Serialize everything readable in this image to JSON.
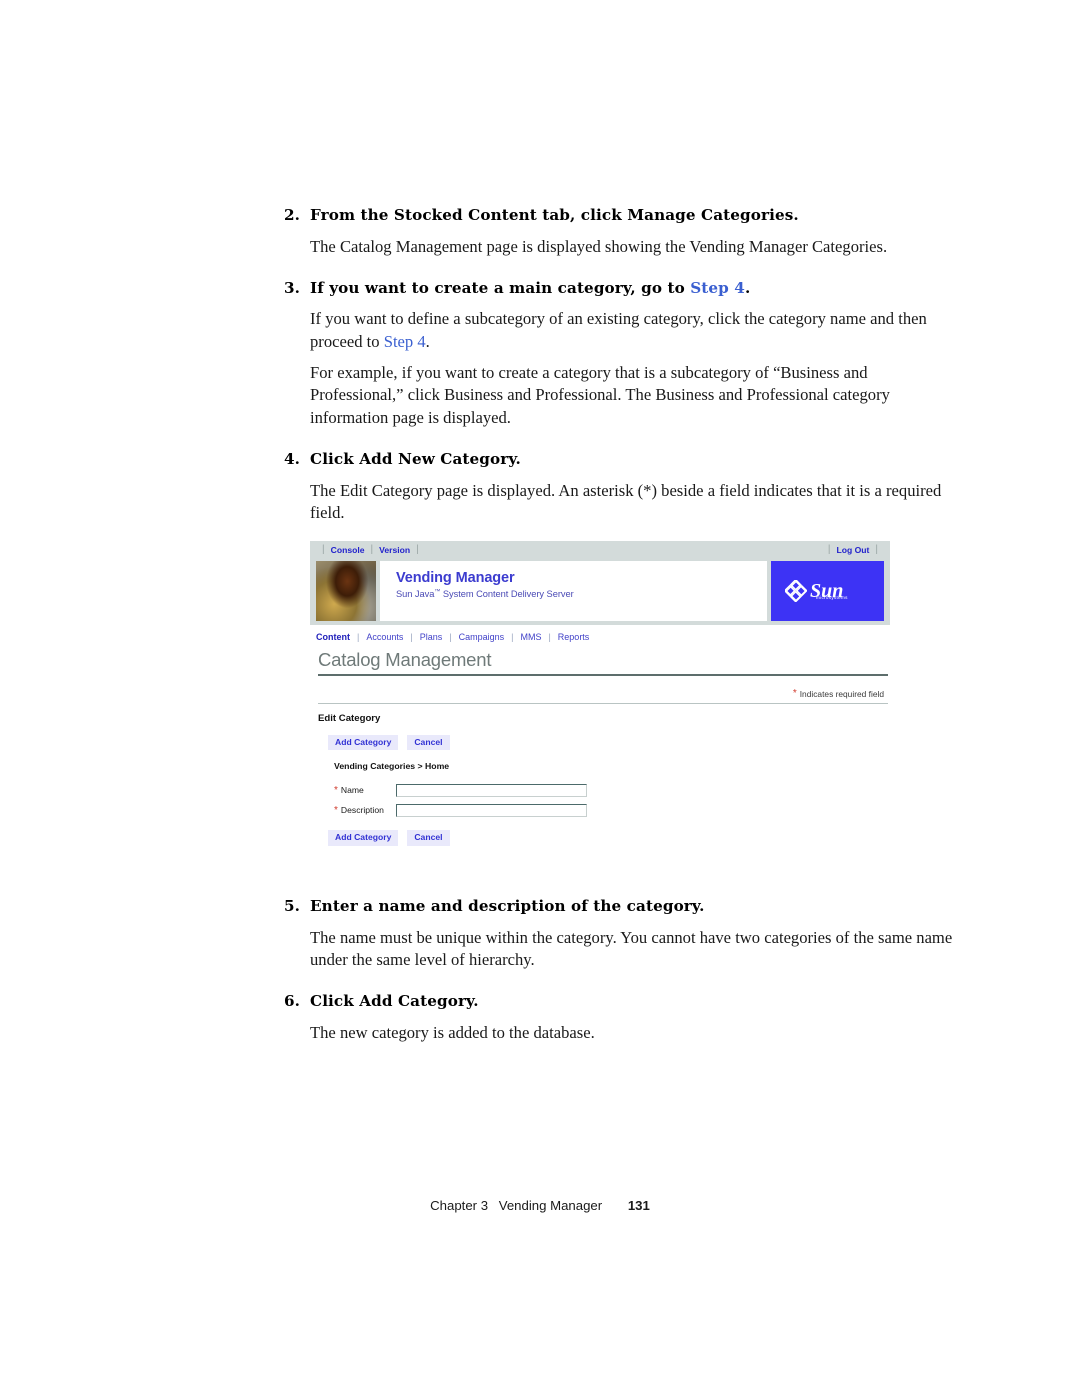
{
  "document": {
    "steps": [
      {
        "number": "2.",
        "heading": "From the Stocked Content tab, click Manage Categories.",
        "body": "The Catalog Management page is displayed showing the Vending Manager Categories."
      },
      {
        "number": "3.",
        "heading_before": "If you want to create a main category, go to ",
        "heading_link": "Step 4",
        "heading_after": ".",
        "body_a_before": "If you want to define a subcategory of an existing category, click the category name and then proceed to ",
        "body_a_link": "Step 4",
        "body_a_after": ".",
        "body_b": "For example, if you want to create a category that is a subcategory of “Business and Professional,” click Business and Professional. The Business and Professional category information page is displayed."
      },
      {
        "number": "4.",
        "heading": "Click Add New Category.",
        "body": "The Edit Category page is displayed. An asterisk (*) beside a field indicates that it is a required field."
      },
      {
        "number": "5.",
        "heading": "Enter a name and description of the category.",
        "body": "The name must be unique within the category. You cannot have two categories of the same name under the same level of hierarchy."
      },
      {
        "number": "6.",
        "heading": "Click Add Category.",
        "body": "The new category is added to the database."
      }
    ]
  },
  "screenshot": {
    "topbar": {
      "console": "Console",
      "version": "Version",
      "logout": "Log Out",
      "separator": "|"
    },
    "banner": {
      "product_title": "Vending Manager",
      "product_subtitle_a": "Sun Java",
      "product_subtitle_tm": "™",
      "product_subtitle_b": " System Content Delivery Server",
      "logo_word": "Sun",
      "logo_sub": "microsystems",
      "logo_bg": "#3d33f5"
    },
    "nav": {
      "items": [
        {
          "label": "Content",
          "active": true
        },
        {
          "label": "Accounts",
          "active": false
        },
        {
          "label": "Plans",
          "active": false
        },
        {
          "label": "Campaigns",
          "active": false
        },
        {
          "label": "MMS",
          "active": false
        },
        {
          "label": "Reports",
          "active": false
        }
      ],
      "separator": "|"
    },
    "page_title": "Catalog Management",
    "required_note": {
      "asterisk": "*",
      "text": "Indicates required field"
    },
    "section_heading": "Edit Category",
    "buttons": {
      "add_category": "Add Category",
      "cancel": "Cancel"
    },
    "breadcrumb": "Vending Categories  >  Home",
    "form": {
      "asterisk": "*",
      "fields": [
        {
          "label": "Name",
          "value": "",
          "placeholder": ""
        },
        {
          "label": "Description",
          "value": "",
          "placeholder": ""
        }
      ]
    },
    "colors": {
      "chrome_bg": "#d3dbda",
      "link_blue": "#2222cc",
      "button_bg": "#e9e9fb",
      "required_red": "#d23b2e",
      "title_gray": "#6f7a79"
    }
  },
  "footer": {
    "chapter": "Chapter 3",
    "section": "Vending Manager",
    "page_number": "131"
  }
}
